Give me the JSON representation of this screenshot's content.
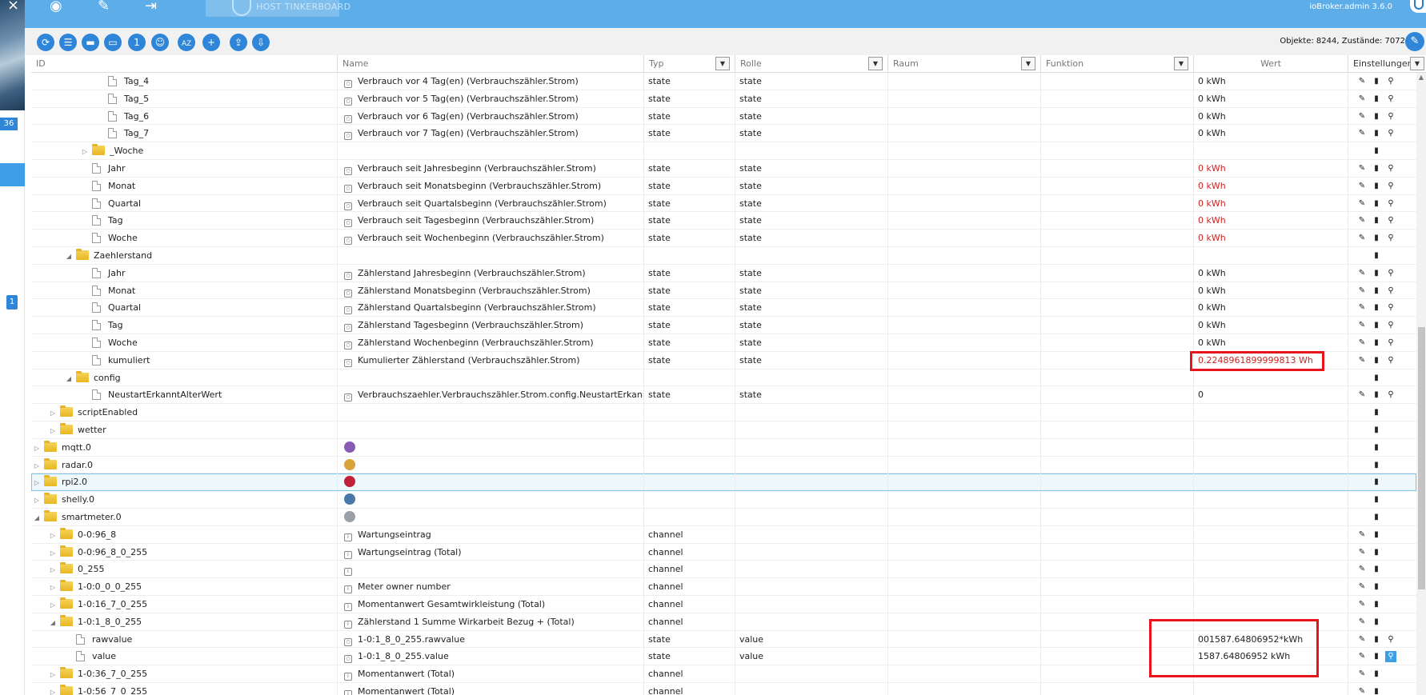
{
  "left": {
    "close": "×",
    "badge1": "36",
    "badge2": "1"
  },
  "topbar": {
    "host": "HOST TINKERBOARD",
    "admin": "ioBroker.admin 3.6.0"
  },
  "toolbar": {
    "buttons": [
      "refresh-icon",
      "list-icon",
      "folder-icon",
      "folder-open-icon",
      "number-icon",
      "contact-icon",
      "sort-az-icon",
      "add-icon",
      "upload-icon",
      "download-icon"
    ],
    "button_glyphs": [
      "⟳",
      "☰",
      "▬",
      "▭",
      "1",
      "☺",
      "AZ",
      "+",
      "⇪",
      "⇩"
    ],
    "stats": "Objekte: 8244, Zustände: 7072"
  },
  "columns": {
    "id": "ID",
    "name": "Name",
    "type": "Typ",
    "role": "Rolle",
    "room": "Raum",
    "function": "Funktion",
    "value": "Wert",
    "settings": "Einstellungen"
  },
  "rows": [
    {
      "indent": 4,
      "exp": "",
      "kind": "file",
      "id": "Tag_4",
      "name": "Verbrauch vor 4 Tag(en) (Verbrauchszähler.Strom)",
      "nicon": "state",
      "type": "state",
      "role": "state",
      "value": "0 kWh",
      "red": false,
      "act": "full"
    },
    {
      "indent": 4,
      "exp": "",
      "kind": "file",
      "id": "Tag_5",
      "name": "Verbrauch vor 5 Tag(en) (Verbrauchszähler.Strom)",
      "nicon": "state",
      "type": "state",
      "role": "state",
      "value": "0 kWh",
      "red": false,
      "act": "full"
    },
    {
      "indent": 4,
      "exp": "",
      "kind": "file",
      "id": "Tag_6",
      "name": "Verbrauch vor 6 Tag(en) (Verbrauchszähler.Strom)",
      "nicon": "state",
      "type": "state",
      "role": "state",
      "value": "0 kWh",
      "red": false,
      "act": "full"
    },
    {
      "indent": 4,
      "exp": "",
      "kind": "file",
      "id": "Tag_7",
      "name": "Verbrauch vor 7 Tag(en) (Verbrauchszähler.Strom)",
      "nicon": "state",
      "type": "state",
      "role": "state",
      "value": "0 kWh",
      "red": false,
      "act": "full"
    },
    {
      "indent": 3,
      "exp": "▷",
      "kind": "folder",
      "id": "_Woche",
      "name": "",
      "nicon": "",
      "type": "",
      "role": "",
      "value": "",
      "red": false,
      "act": "del"
    },
    {
      "indent": 3,
      "exp": "",
      "kind": "file",
      "id": "Jahr",
      "name": "Verbrauch seit Jahresbeginn (Verbrauchszähler.Strom)",
      "nicon": "state",
      "type": "state",
      "role": "state",
      "value": "0 kWh",
      "red": true,
      "act": "full"
    },
    {
      "indent": 3,
      "exp": "",
      "kind": "file",
      "id": "Monat",
      "name": "Verbrauch seit Monatsbeginn (Verbrauchszähler.Strom)",
      "nicon": "state",
      "type": "state",
      "role": "state",
      "value": "0 kWh",
      "red": true,
      "act": "full"
    },
    {
      "indent": 3,
      "exp": "",
      "kind": "file",
      "id": "Quartal",
      "name": "Verbrauch seit Quartalsbeginn (Verbrauchszähler.Strom)",
      "nicon": "state",
      "type": "state",
      "role": "state",
      "value": "0 kWh",
      "red": true,
      "act": "full"
    },
    {
      "indent": 3,
      "exp": "",
      "kind": "file",
      "id": "Tag",
      "name": "Verbrauch seit Tagesbeginn (Verbrauchszähler.Strom)",
      "nicon": "state",
      "type": "state",
      "role": "state",
      "value": "0 kWh",
      "red": true,
      "act": "full"
    },
    {
      "indent": 3,
      "exp": "",
      "kind": "file",
      "id": "Woche",
      "name": "Verbrauch seit Wochenbeginn (Verbrauchszähler.Strom)",
      "nicon": "state",
      "type": "state",
      "role": "state",
      "value": "0 kWh",
      "red": true,
      "act": "full"
    },
    {
      "indent": 2,
      "exp": "◢",
      "kind": "folder",
      "id": "Zaehlerstand",
      "name": "",
      "nicon": "",
      "type": "",
      "role": "",
      "value": "",
      "red": false,
      "act": "del"
    },
    {
      "indent": 3,
      "exp": "",
      "kind": "file",
      "id": "Jahr",
      "name": "Zählerstand Jahresbeginn (Verbrauchszähler.Strom)",
      "nicon": "state",
      "type": "state",
      "role": "state",
      "value": "0 kWh",
      "red": false,
      "act": "full"
    },
    {
      "indent": 3,
      "exp": "",
      "kind": "file",
      "id": "Monat",
      "name": "Zählerstand Monatsbeginn (Verbrauchszähler.Strom)",
      "nicon": "state",
      "type": "state",
      "role": "state",
      "value": "0 kWh",
      "red": false,
      "act": "full"
    },
    {
      "indent": 3,
      "exp": "",
      "kind": "file",
      "id": "Quartal",
      "name": "Zählerstand Quartalsbeginn (Verbrauchszähler.Strom)",
      "nicon": "state",
      "type": "state",
      "role": "state",
      "value": "0 kWh",
      "red": false,
      "act": "full"
    },
    {
      "indent": 3,
      "exp": "",
      "kind": "file",
      "id": "Tag",
      "name": "Zählerstand Tagesbeginn (Verbrauchszähler.Strom)",
      "nicon": "state",
      "type": "state",
      "role": "state",
      "value": "0 kWh",
      "red": false,
      "act": "full"
    },
    {
      "indent": 3,
      "exp": "",
      "kind": "file",
      "id": "Woche",
      "name": "Zählerstand Wochenbeginn (Verbrauchszähler.Strom)",
      "nicon": "state",
      "type": "state",
      "role": "state",
      "value": "0 kWh",
      "red": false,
      "act": "full"
    },
    {
      "indent": 3,
      "exp": "",
      "kind": "file",
      "id": "kumuliert",
      "name": "Kumulierter Zählerstand (Verbrauchszähler.Strom)",
      "nicon": "state",
      "type": "state",
      "role": "state",
      "value": "0.2248961899999813 Wh",
      "red": true,
      "act": "full"
    },
    {
      "indent": 2,
      "exp": "◢",
      "kind": "folder",
      "id": "config",
      "name": "",
      "nicon": "",
      "type": "",
      "role": "",
      "value": "",
      "red": false,
      "act": "del"
    },
    {
      "indent": 3,
      "exp": "",
      "kind": "file",
      "id": "NeustartErkanntAlterWert",
      "name": "Verbrauchszaehler.Verbrauchszähler.Strom.config.NeustartErkanntA...",
      "nicon": "state",
      "type": "state",
      "role": "state",
      "value": "0",
      "red": false,
      "act": "full"
    },
    {
      "indent": 1,
      "exp": "▷",
      "kind": "folder",
      "id": "scriptEnabled",
      "name": "",
      "nicon": "",
      "type": "",
      "role": "",
      "value": "",
      "red": false,
      "act": "del"
    },
    {
      "indent": 1,
      "exp": "▷",
      "kind": "folder",
      "id": "wetter",
      "name": "",
      "nicon": "",
      "type": "",
      "role": "",
      "value": "",
      "red": false,
      "act": "del"
    },
    {
      "indent": 0,
      "exp": "▷",
      "kind": "folder",
      "id": "mqtt.0",
      "name": "",
      "nicon": "mqtt",
      "type": "",
      "role": "",
      "value": "",
      "red": false,
      "act": "del"
    },
    {
      "indent": 0,
      "exp": "▷",
      "kind": "folder",
      "id": "radar.0",
      "name": "",
      "nicon": "radar",
      "type": "",
      "role": "",
      "value": "",
      "red": false,
      "act": "del"
    },
    {
      "indent": 0,
      "exp": "▷",
      "kind": "folder",
      "id": "rpi2.0",
      "name": "",
      "nicon": "rpi",
      "type": "",
      "role": "",
      "value": "",
      "red": false,
      "act": "del",
      "sel": true
    },
    {
      "indent": 0,
      "exp": "▷",
      "kind": "folder",
      "id": "shelly.0",
      "name": "",
      "nicon": "shelly",
      "type": "",
      "role": "",
      "value": "",
      "red": false,
      "act": "del"
    },
    {
      "indent": 0,
      "exp": "◢",
      "kind": "folder",
      "id": "smartmeter.0",
      "name": "",
      "nicon": "smartmeter",
      "type": "",
      "role": "",
      "value": "",
      "red": false,
      "act": "del"
    },
    {
      "indent": 1,
      "exp": "▷",
      "kind": "folder",
      "id": "0-0:96_8",
      "name": "Wartungseintrag",
      "nicon": "channel",
      "type": "channel",
      "role": "",
      "value": "",
      "red": false,
      "act": "edit"
    },
    {
      "indent": 1,
      "exp": "▷",
      "kind": "folder",
      "id": "0-0:96_8_0_255",
      "name": "Wartungseintrag (Total)",
      "nicon": "channel",
      "type": "channel",
      "role": "",
      "value": "",
      "red": false,
      "act": "edit"
    },
    {
      "indent": 1,
      "exp": "▷",
      "kind": "folder",
      "id": "0_255",
      "name": "",
      "nicon": "channel",
      "type": "channel",
      "role": "",
      "value": "",
      "red": false,
      "act": "edit"
    },
    {
      "indent": 1,
      "exp": "▷",
      "kind": "folder",
      "id": "1-0:0_0_0_255",
      "name": "Meter owner number",
      "nicon": "channel",
      "type": "channel",
      "role": "",
      "value": "",
      "red": false,
      "act": "edit"
    },
    {
      "indent": 1,
      "exp": "▷",
      "kind": "folder",
      "id": "1-0:16_7_0_255",
      "name": "Momentanwert Gesamtwirkleistung (Total)",
      "nicon": "channel",
      "type": "channel",
      "role": "",
      "value": "",
      "red": false,
      "act": "edit"
    },
    {
      "indent": 1,
      "exp": "◢",
      "kind": "folder",
      "id": "1-0:1_8_0_255",
      "name": "Zählerstand 1 Summe Wirkarbeit Bezug + (Total)",
      "nicon": "channel",
      "type": "channel",
      "role": "",
      "value": "",
      "red": false,
      "act": "edit"
    },
    {
      "indent": 2,
      "exp": "",
      "kind": "file",
      "id": "rawvalue",
      "name": "1-0:1_8_0_255.rawvalue",
      "nicon": "state",
      "type": "state",
      "role": "value",
      "value": "001587.64806952*kWh",
      "red": false,
      "act": "full"
    },
    {
      "indent": 2,
      "exp": "",
      "kind": "file",
      "id": "value",
      "name": "1-0:1_8_0_255.value",
      "nicon": "state",
      "type": "state",
      "role": "value",
      "value": "1587.64806952 kWh",
      "red": false,
      "act": "full",
      "hl": true
    },
    {
      "indent": 1,
      "exp": "▷",
      "kind": "folder",
      "id": "1-0:36_7_0_255",
      "name": "Momentanwert (Total)",
      "nicon": "channel",
      "type": "channel",
      "role": "",
      "value": "",
      "red": false,
      "act": "edit"
    },
    {
      "indent": 1,
      "exp": "▷",
      "kind": "folder",
      "id": "1-0:56_7_0_255",
      "name": "Momentanwert (Total)",
      "nicon": "channel",
      "type": "channel",
      "role": "",
      "value": "",
      "red": false,
      "act": "edit"
    }
  ],
  "colors": {
    "accent": "#2f86d8",
    "topbar": "#5dade8",
    "annotation": "#e8141c",
    "value_error": "#c22"
  }
}
